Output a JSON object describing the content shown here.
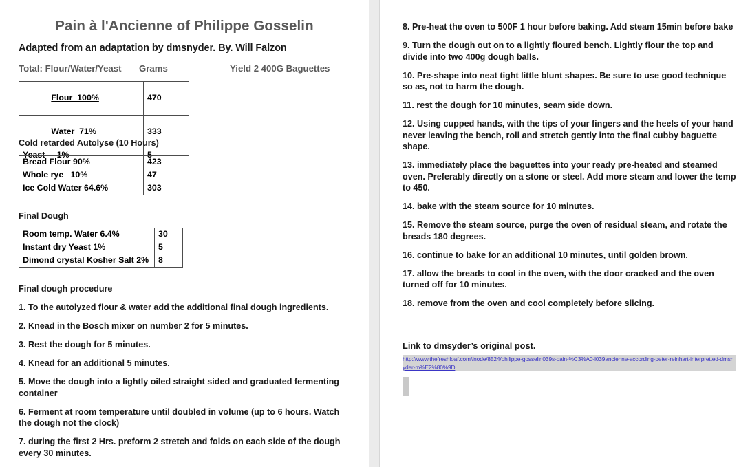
{
  "document": {
    "title": "Pain à l'Ancienne of Philippe Gosselin",
    "subtitle": "Adapted from an adaptation by dmsnyder. By. Will Falzon",
    "title_color": "#595959",
    "body_color": "#1a1a1a"
  },
  "totals_header": {
    "label": "Total: Flour/Water/Yeast",
    "grams": "Grams",
    "yield": "Yield 2 400G Baguettes"
  },
  "tables": {
    "totals": {
      "rows": [
        {
          "name": "Flour  100%",
          "value": "470",
          "underline": true
        },
        {
          "name": "Water  71%",
          "value": "333",
          "underline": true
        },
        {
          "name": "Yeast     1%",
          "value": "5",
          "underline": false
        }
      ]
    },
    "autolyse": {
      "heading": "Cold retarded Autolyse (10 Hours)",
      "rows": [
        {
          "name": "Bread Flour 90%",
          "value": "423",
          "underline": false
        },
        {
          "name": "Whole rye   10%",
          "value": "47",
          "underline": false
        },
        {
          "name": "Ice Cold Water 64.6%",
          "value": "303",
          "underline": false
        }
      ]
    },
    "final_dough": {
      "heading": "Final Dough",
      "rows": [
        {
          "name": "Room temp. Water 6.4%",
          "value": "30",
          "underline": false
        },
        {
          "name": "Instant dry Yeast 1%",
          "value": "5",
          "underline": false
        },
        {
          "name": "Dimond crystal Kosher Salt 2%",
          "value": "8",
          "underline": false
        }
      ]
    }
  },
  "procedure": {
    "heading": "Final dough procedure",
    "steps_left": [
      "1. To the autolyzed flour & water add the additional final dough ingredients.",
      "2. Knead in the Bosch mixer on number 2 for 5 minutes.",
      "3. Rest the dough for 5 minutes.",
      "4. Knead for an additional 5 minutes.",
      "5. Move the dough into a lightly oiled straight sided and graduated fermenting container",
      "6. Ferment at room temperature until doubled in volume (up to 6 hours. Watch the dough not the clock)",
      "7. during the first 2 Hrs. preform 2 stretch and folds on each side of the dough every 30 minutes."
    ],
    "steps_right": [
      "8. Pre-heat the oven to 500F 1 hour before baking. Add steam 15min before bake",
      "9. Turn the dough out on to a lightly floured bench. Lightly flour the top and divide into two 400g dough balls.",
      "10.  Pre-shape into neat tight little blunt shapes. Be sure to use good technique so as, not to harm the dough.",
      "11. rest the dough for 10 minutes, seam side down.",
      "12. Using cupped hands, with the tips of your fingers and the heels of your hand never leaving the bench, roll and stretch gently into the final cubby baguette shape.",
      "13. immediately place the baguettes into your ready pre-heated and steamed oven. Preferably directly on a stone or steel. Add more steam and lower the temp to 450.",
      "14. bake with the steam source for 10 minutes.",
      "15. Remove the steam source, purge the oven of residual steam, and rotate the breads 180 degrees.",
      "16. continue to bake for an additional 10 minutes, until golden brown.",
      "17. allow the breads to cool in the oven, with the door cracked and the oven turned off for 10 minutes.",
      "18. remove from the oven and cool completely before slicing."
    ]
  },
  "link_section": {
    "heading": "Link to dmsyder’s original post.",
    "url": "http://www.thefreshloaf.com//node/8524/philippe-gosselin039s-pain-%C3%A0-l039ancienne-according-peter-reinhart-interpretted-dmsnyder-m%E2%80%9D",
    "url_color": "#3b36c6",
    "url_highlight": "#d4d4d4"
  }
}
